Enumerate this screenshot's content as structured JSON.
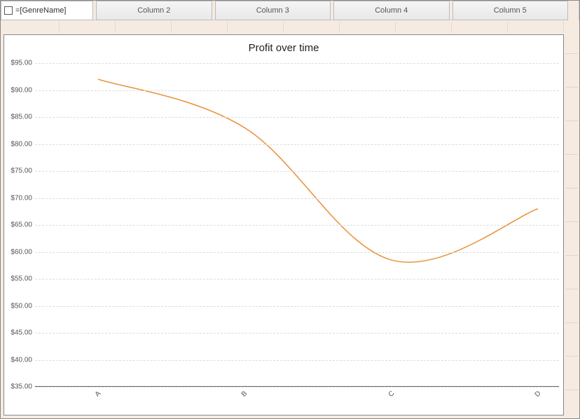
{
  "header": {
    "genre_label": "=[GenreName]",
    "columns": [
      "Column 2",
      "Column 3",
      "Column 4",
      "Column 5"
    ]
  },
  "chart_data": {
    "type": "line",
    "title": "Profit over time",
    "xlabel": "",
    "ylabel": "",
    "categories": [
      "A",
      "B",
      "C",
      "D"
    ],
    "values": [
      92,
      83,
      58.5,
      68
    ],
    "ylim": [
      35,
      95
    ],
    "y_ticks": [
      35,
      40,
      45,
      50,
      55,
      60,
      65,
      70,
      75,
      80,
      85,
      90,
      95
    ],
    "y_tick_labels": [
      "$35.00",
      "$40.00",
      "$45.00",
      "$50.00",
      "$55.00",
      "$60.00",
      "$65.00",
      "$70.00",
      "$75.00",
      "$80.00",
      "$85.00",
      "$90.00",
      "$95.00"
    ],
    "series_color": "#e8903a"
  }
}
